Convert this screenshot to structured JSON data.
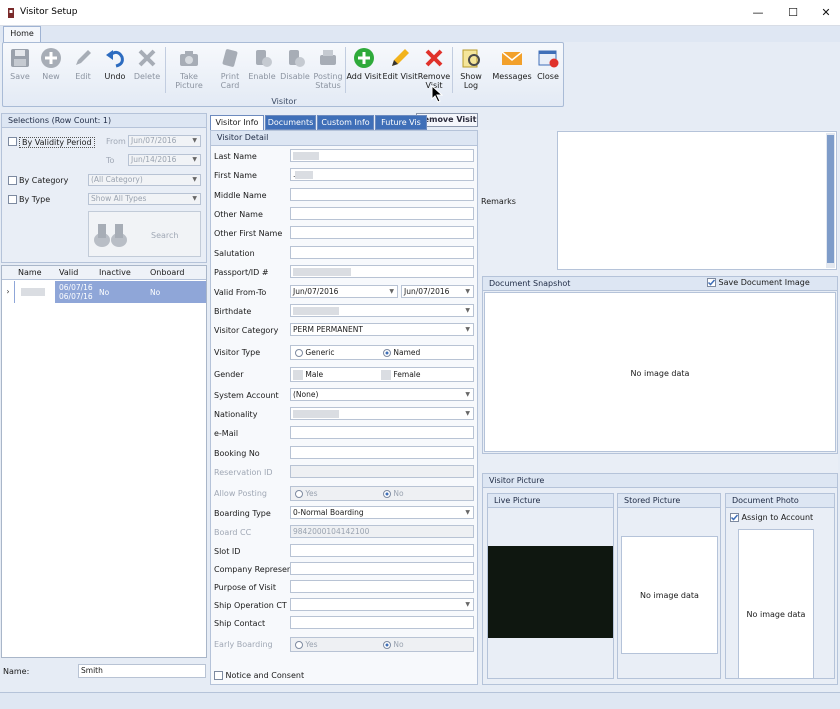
{
  "window": {
    "title": "Visitor Setup",
    "minimize": "—",
    "maximize": "☐",
    "close": "✕"
  },
  "ribbon": {
    "tab": "Home",
    "group_label": "Visitor",
    "buttons": [
      {
        "label": "Save",
        "icon": "save-icon",
        "enabled": false
      },
      {
        "label": "New",
        "icon": "plus-icon",
        "enabled": false
      },
      {
        "label": "Edit",
        "icon": "pencil-icon",
        "enabled": false
      },
      {
        "label": "Undo",
        "icon": "undo-icon",
        "enabled": true
      },
      {
        "label": "Delete",
        "icon": "delete-icon",
        "enabled": false
      },
      {
        "label": "Take Picture",
        "icon": "camera-icon",
        "enabled": false
      },
      {
        "label": "Print Card",
        "icon": "print-card-icon",
        "enabled": false
      },
      {
        "label": "Enable",
        "icon": "enable-icon",
        "enabled": false
      },
      {
        "label": "Disable",
        "icon": "disable-icon",
        "enabled": false
      },
      {
        "label": "Posting Status",
        "icon": "posting-status-icon",
        "enabled": false
      },
      {
        "label": "Add Visit",
        "icon": "add-visit-icon",
        "enabled": true
      },
      {
        "label": "Edit Visit",
        "icon": "edit-visit-icon",
        "enabled": true
      },
      {
        "label": "Remove Visit",
        "icon": "remove-visit-icon",
        "enabled": true
      },
      {
        "label": "Show Log",
        "icon": "show-log-icon",
        "enabled": true
      },
      {
        "label": "Messages",
        "icon": "envelope-icon",
        "enabled": true
      },
      {
        "label": "Close",
        "icon": "close-window-icon",
        "enabled": true
      }
    ],
    "tooltip": "Remove Visit"
  },
  "selections": {
    "header": "Selections (Row Count: 1)",
    "by_validity_label": "By Validity Period",
    "from_label": "From",
    "from_value": "Jun/07/2016",
    "to_label": "To",
    "to_value": "Jun/14/2016",
    "by_category_label": "By Category",
    "category_value": "(All Category)",
    "by_type_label": "By Type",
    "type_value": "Show All Types",
    "search_label": "Search"
  },
  "grid": {
    "columns": [
      "Name",
      "Valid",
      "Inactive",
      "Onboard"
    ],
    "rows": [
      {
        "valid_from": "06/07/16",
        "valid_to": "06/07/16",
        "inactive": "No",
        "onboard": "No"
      }
    ]
  },
  "name_filter": {
    "label": "Name:",
    "value": "Smith"
  },
  "visitor_tabs": [
    "Visitor Info",
    "Documents",
    "Custom Info",
    "Future Vis"
  ],
  "visitor_detail": {
    "header": "Visitor Detail",
    "labels": {
      "last_name": "Last Name",
      "first_name": "First Name",
      "middle_name": "Middle Name",
      "other_name": "Other Name",
      "other_first_name": "Other First Name",
      "salutation": "Salutation",
      "passport": "Passport/ID #",
      "valid_from_to": "Valid From-To",
      "birthdate": "Birthdate",
      "visitor_category": "Visitor Category",
      "visitor_type": "Visitor Type",
      "gender": "Gender",
      "system_account": "System Account",
      "nationality": "Nationality",
      "email": "e-Mail",
      "booking_no": "Booking No",
      "reservation_id": "Reservation ID",
      "allow_posting": "Allow Posting",
      "boarding_type": "Boarding Type",
      "board_cc": "Board CC",
      "slot_id": "Slot ID",
      "company_represent": "Company Represent",
      "purpose_of_visit": "Purpose of Visit",
      "ship_operation_ct": "Ship Operation CT",
      "ship_contact": "Ship Contact",
      "early_boarding": "Early Boarding"
    },
    "values": {
      "first_name_prefix": ".",
      "valid_from": "Jun/07/2016",
      "valid_to": "Jun/07/2016",
      "visitor_category": "PERM PERMANENT",
      "visitor_type_generic": "Generic",
      "visitor_type_named": "Named",
      "gender_male": "Male",
      "gender_female": "Female",
      "system_account": "(None)",
      "allow_yes": "Yes",
      "allow_no": "No",
      "boarding_type": "0-Normal Boarding",
      "board_cc": "9842000104142100",
      "early_yes": "Yes",
      "early_no": "No"
    },
    "consent_label": "Notice and Consent"
  },
  "right": {
    "remarks_label": "Remarks",
    "snapshot_header": "Document Snapshot",
    "save_doc_image_label": "Save Document Image",
    "no_image": "No image data",
    "visitor_picture_header": "Visitor Picture",
    "live_picture": "Live Picture",
    "stored_picture": "Stored Picture",
    "document_photo": "Document Photo",
    "assign_to_account": "Assign to Account"
  },
  "colors": {
    "accent": "#3f6fb8",
    "selection": "#8fa6d8",
    "panel": "#e9eef6"
  }
}
